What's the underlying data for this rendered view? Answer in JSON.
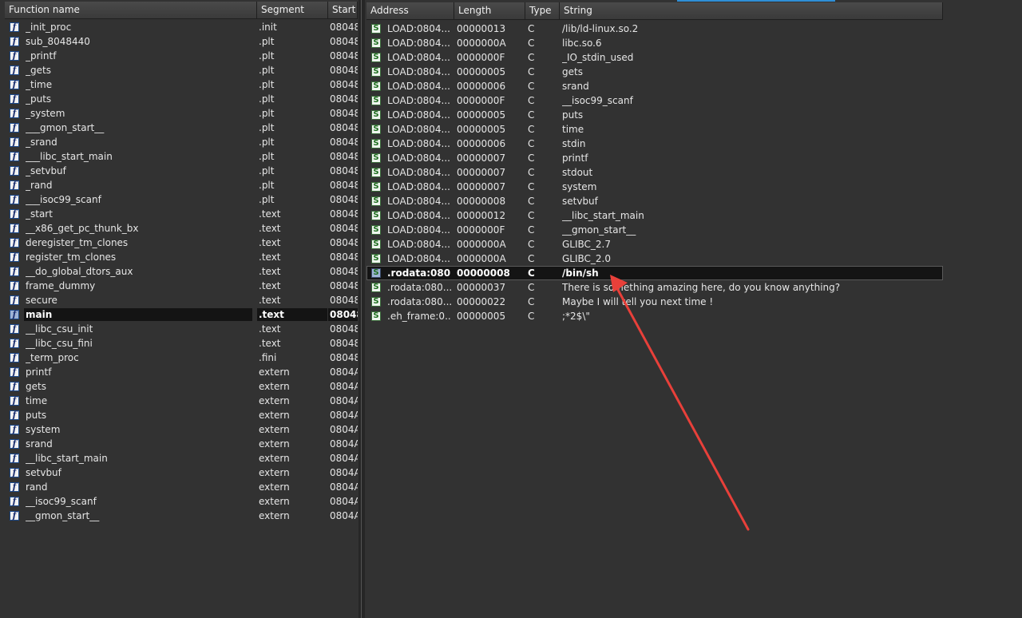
{
  "functions_panel": {
    "columns": [
      "Function name",
      "Segment",
      "Start"
    ],
    "rows": [
      {
        "name": "_init_proc",
        "segment": ".init",
        "start": "08048"
      },
      {
        "name": "sub_8048440",
        "segment": ".plt",
        "start": "08048"
      },
      {
        "name": "_printf",
        "segment": ".plt",
        "start": "08048"
      },
      {
        "name": "_gets",
        "segment": ".plt",
        "start": "08048"
      },
      {
        "name": "_time",
        "segment": ".plt",
        "start": "08048"
      },
      {
        "name": "_puts",
        "segment": ".plt",
        "start": "08048"
      },
      {
        "name": "_system",
        "segment": ".plt",
        "start": "08048"
      },
      {
        "name": "___gmon_start__",
        "segment": ".plt",
        "start": "08048"
      },
      {
        "name": "_srand",
        "segment": ".plt",
        "start": "08048"
      },
      {
        "name": "___libc_start_main",
        "segment": ".plt",
        "start": "08048"
      },
      {
        "name": "_setvbuf",
        "segment": ".plt",
        "start": "08048"
      },
      {
        "name": "_rand",
        "segment": ".plt",
        "start": "08048"
      },
      {
        "name": "___isoc99_scanf",
        "segment": ".plt",
        "start": "08048"
      },
      {
        "name": "_start",
        "segment": ".text",
        "start": "08048"
      },
      {
        "name": "__x86_get_pc_thunk_bx",
        "segment": ".text",
        "start": "08048"
      },
      {
        "name": "deregister_tm_clones",
        "segment": ".text",
        "start": "08048"
      },
      {
        "name": "register_tm_clones",
        "segment": ".text",
        "start": "08048"
      },
      {
        "name": "__do_global_dtors_aux",
        "segment": ".text",
        "start": "08048"
      },
      {
        "name": "frame_dummy",
        "segment": ".text",
        "start": "08048"
      },
      {
        "name": "secure",
        "segment": ".text",
        "start": "08048"
      },
      {
        "name": "main",
        "segment": ".text",
        "start": "08048",
        "selected": true
      },
      {
        "name": "__libc_csu_init",
        "segment": ".text",
        "start": "08048"
      },
      {
        "name": "__libc_csu_fini",
        "segment": ".text",
        "start": "08048"
      },
      {
        "name": "_term_proc",
        "segment": ".fini",
        "start": "08048"
      },
      {
        "name": "printf",
        "segment": "extern",
        "start": "0804A"
      },
      {
        "name": "gets",
        "segment": "extern",
        "start": "0804A"
      },
      {
        "name": "time",
        "segment": "extern",
        "start": "0804A"
      },
      {
        "name": "puts",
        "segment": "extern",
        "start": "0804A"
      },
      {
        "name": "system",
        "segment": "extern",
        "start": "0804A"
      },
      {
        "name": "srand",
        "segment": "extern",
        "start": "0804A"
      },
      {
        "name": "__libc_start_main",
        "segment": "extern",
        "start": "0804A"
      },
      {
        "name": "setvbuf",
        "segment": "extern",
        "start": "0804A"
      },
      {
        "name": "rand",
        "segment": "extern",
        "start": "0804A"
      },
      {
        "name": "__isoc99_scanf",
        "segment": "extern",
        "start": "0804A"
      },
      {
        "name": "__gmon_start__",
        "segment": "extern",
        "start": "0804A"
      }
    ]
  },
  "strings_panel": {
    "columns": [
      "Address",
      "Length",
      "Type",
      "String"
    ],
    "rows": [
      {
        "address": "LOAD:0804...",
        "length": "00000013",
        "type": "C",
        "string": "/lib/ld-linux.so.2"
      },
      {
        "address": "LOAD:0804...",
        "length": "0000000A",
        "type": "C",
        "string": "libc.so.6"
      },
      {
        "address": "LOAD:0804...",
        "length": "0000000F",
        "type": "C",
        "string": "_IO_stdin_used"
      },
      {
        "address": "LOAD:0804...",
        "length": "00000005",
        "type": "C",
        "string": "gets"
      },
      {
        "address": "LOAD:0804...",
        "length": "00000006",
        "type": "C",
        "string": "srand"
      },
      {
        "address": "LOAD:0804...",
        "length": "0000000F",
        "type": "C",
        "string": "__isoc99_scanf"
      },
      {
        "address": "LOAD:0804...",
        "length": "00000005",
        "type": "C",
        "string": "puts"
      },
      {
        "address": "LOAD:0804...",
        "length": "00000005",
        "type": "C",
        "string": "time"
      },
      {
        "address": "LOAD:0804...",
        "length": "00000006",
        "type": "C",
        "string": "stdin"
      },
      {
        "address": "LOAD:0804...",
        "length": "00000007",
        "type": "C",
        "string": "printf"
      },
      {
        "address": "LOAD:0804...",
        "length": "00000007",
        "type": "C",
        "string": "stdout"
      },
      {
        "address": "LOAD:0804...",
        "length": "00000007",
        "type": "C",
        "string": "system"
      },
      {
        "address": "LOAD:0804...",
        "length": "00000008",
        "type": "C",
        "string": "setvbuf"
      },
      {
        "address": "LOAD:0804...",
        "length": "00000012",
        "type": "C",
        "string": "__libc_start_main"
      },
      {
        "address": "LOAD:0804...",
        "length": "0000000F",
        "type": "C",
        "string": "__gmon_start__"
      },
      {
        "address": "LOAD:0804...",
        "length": "0000000A",
        "type": "C",
        "string": "GLIBC_2.7"
      },
      {
        "address": "LOAD:0804...",
        "length": "0000000A",
        "type": "C",
        "string": "GLIBC_2.0"
      },
      {
        "address": ".rodata:080...",
        "length": "00000008",
        "type": "C",
        "string": "/bin/sh",
        "selected": true
      },
      {
        "address": ".rodata:080...",
        "length": "00000037",
        "type": "C",
        "string": "There is something amazing here, do you know anything?"
      },
      {
        "address": ".rodata:080...",
        "length": "00000022",
        "type": "C",
        "string": "Maybe I will tell you next time !"
      },
      {
        "address": ".eh_frame:0...",
        "length": "00000005",
        "type": "C",
        "string": ";*2$\\\""
      }
    ]
  },
  "icons": {
    "function": "f",
    "string": "S"
  },
  "colors": {
    "background": "#323232",
    "selection": "#141414",
    "annotation_arrow": "#e8403a",
    "active_tab": "#2f8fd6"
  }
}
